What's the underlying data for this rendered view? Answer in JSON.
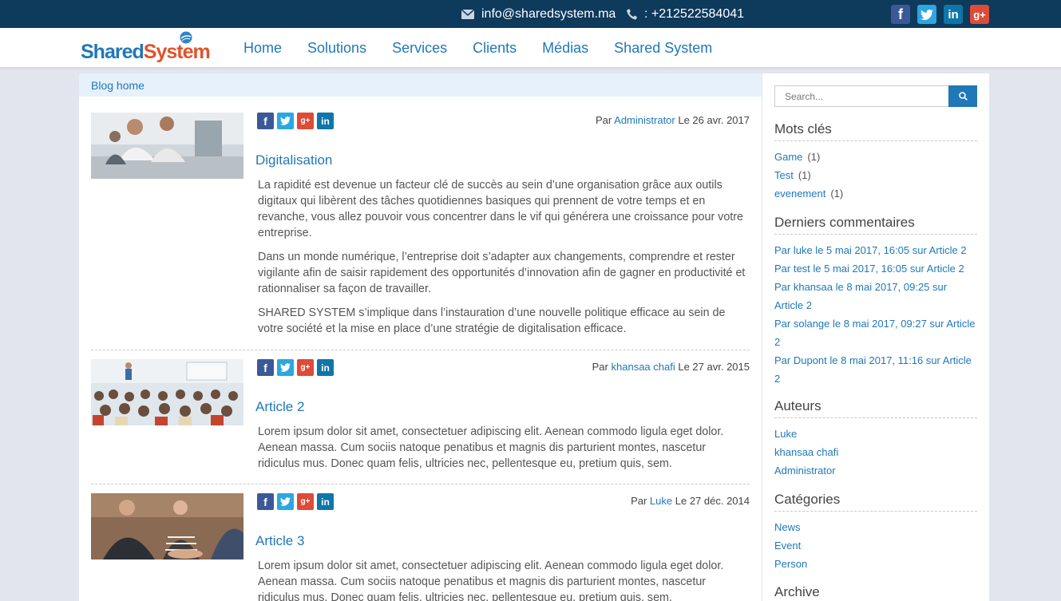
{
  "topbar": {
    "email": "info@sharedsystem.ma",
    "phone": ": +212522584041",
    "social": [
      "facebook",
      "twitter",
      "linkedin",
      "google-plus"
    ]
  },
  "logo": {
    "part1": "Shared",
    "part2": "System"
  },
  "nav": [
    "Home",
    "Solutions",
    "Services",
    "Clients",
    "Médias",
    "Shared System"
  ],
  "breadcrumb": "Blog home",
  "articles": [
    {
      "by": "Par",
      "author": "Administrator",
      "date": "Le 26 avr. 2017",
      "title": "Digitalisation",
      "paragraphs": [
        "La  rapidité est devenue un facteur clé de succès au sein d’une organisation grâce aux outils digitaux  qui libèrent des tâches quotidiennes basiques qui prennent de votre temps et en revanche, vous allez pouvoir vous concentrer dans le vif qui générera une croissance pour votre entreprise.",
        "Dans un monde numérique, l’entreprise doit s’adapter aux changements,  comprendre et rester vigilante afin de saisir rapidement des opportunités d’innovation afin de gagner en productivité et rationnaliser sa façon de travailler.",
        "SHARED SYSTEM  s’implique dans  l’instauration d’une nouvelle politique efficace au sein de votre  société et la mise en place d’une stratégie de digitalisation efficace."
      ]
    },
    {
      "by": "Par",
      "author": "khansaa chafi",
      "date": "Le 27 avr. 2015",
      "title": "Article 2",
      "paragraphs": [
        "Lorem ipsum dolor sit amet, consectetuer adipiscing elit. Aenean commodo ligula eget dolor. Aenean massa. Cum sociis natoque penatibus et magnis dis parturient montes, nascetur ridiculus mus. Donec quam felis, ultricies nec, pellentesque eu, pretium quis, sem."
      ]
    },
    {
      "by": "Par",
      "author": "Luke",
      "date": "Le 27 déc. 2014",
      "title": "Article 3",
      "paragraphs": [
        "Lorem ipsum dolor sit amet, consectetuer adipiscing elit. Aenean commodo ligula eget dolor. Aenean massa. Cum sociis natoque penatibus et magnis dis parturient montes, nascetur ridiculus mus. Donec quam felis, ultricies nec, pellentesque eu, pretium quis, sem."
      ]
    }
  ],
  "sidebar": {
    "search_placeholder": "Search...",
    "tags": {
      "title": "Mots clés",
      "items": [
        {
          "label": "Game",
          "count": "(1)"
        },
        {
          "label": "Test",
          "count": "(1)"
        },
        {
          "label": "evenement",
          "count": "(1)"
        }
      ]
    },
    "comments": {
      "title": "Derniers commentaires",
      "items": [
        "Par luke le 5 mai 2017, 16:05 sur Article 2",
        "Par test le 5 mai 2017, 16:05 sur Article 2",
        "Par khansaa le 8 mai 2017, 09:25 sur Article 2",
        "Par solange le 8 mai 2017, 09:27 sur Article 2",
        "Par Dupont le 8 mai 2017, 11:16 sur Article 2"
      ]
    },
    "authors": {
      "title": "Auteurs",
      "items": [
        "Luke",
        "khansaa chafi",
        "Administrator"
      ]
    },
    "categories": {
      "title": "Catégories",
      "items": [
        "News",
        "Event",
        "Person"
      ]
    },
    "archive": {
      "title": "Archive"
    }
  },
  "colors": {
    "topbar": "#0e3a5c",
    "link": "#1f78b8",
    "accent": "#e2522b",
    "background": "#e2e5ee"
  }
}
